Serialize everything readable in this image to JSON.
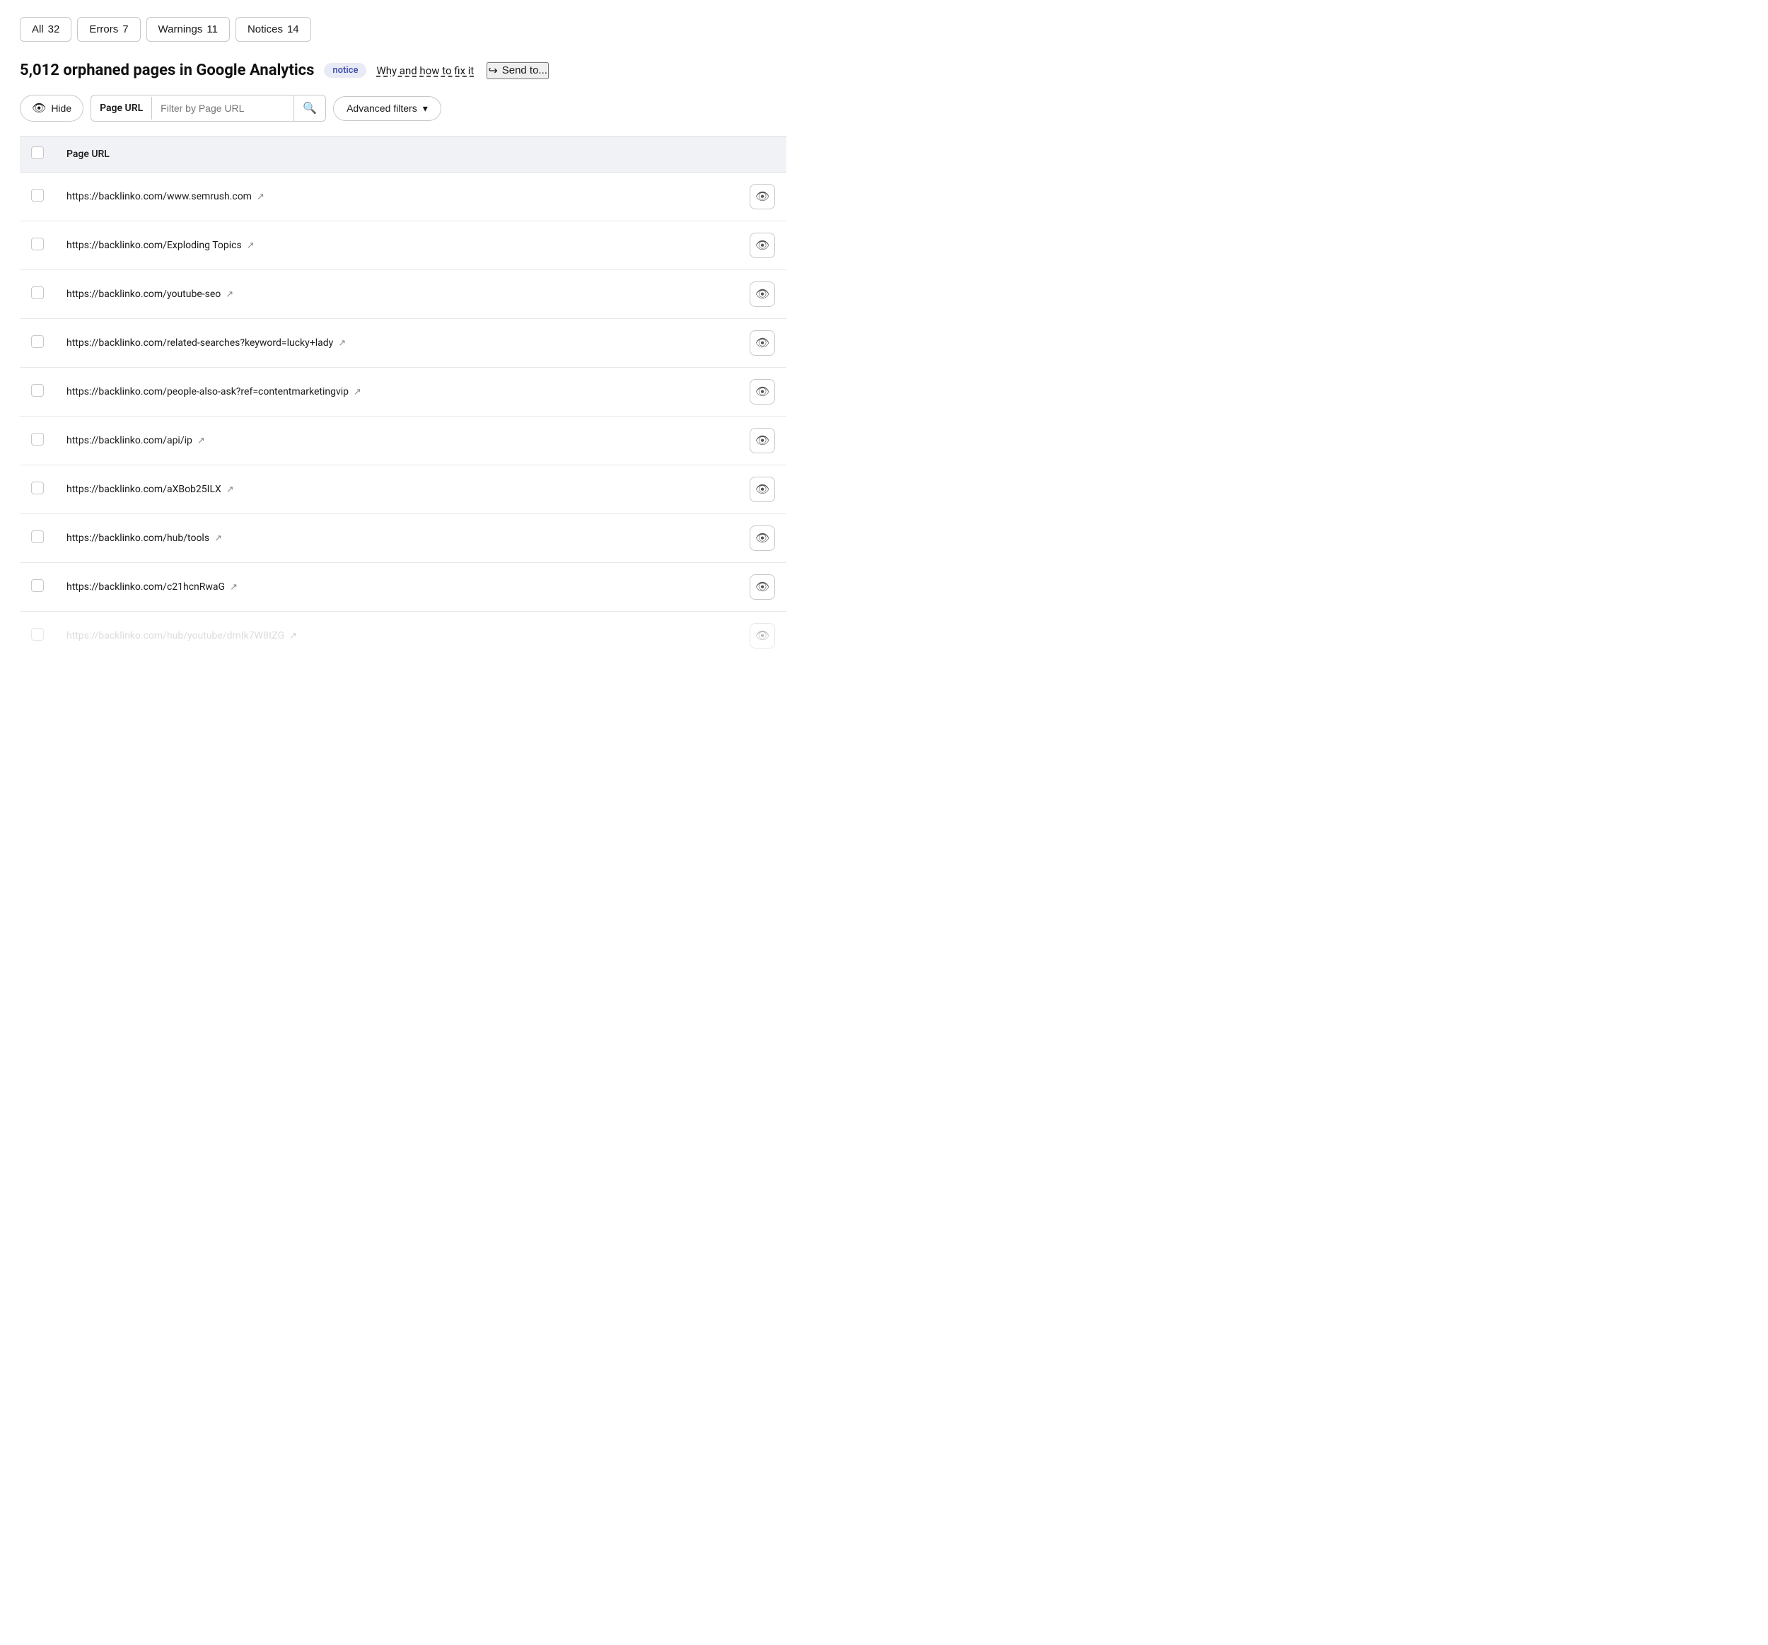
{
  "tabs": [
    {
      "label": "All",
      "count": "32",
      "id": "all"
    },
    {
      "label": "Errors",
      "count": "7",
      "id": "errors"
    },
    {
      "label": "Warnings",
      "count": "11",
      "id": "warnings"
    },
    {
      "label": "Notices",
      "count": "14",
      "id": "notices"
    }
  ],
  "heading": {
    "title": "5,012 orphaned pages in Google Analytics",
    "badge": "notice",
    "fix_link": "Why and how to fix it",
    "send_to": "Send to..."
  },
  "filters": {
    "hide_label": "Hide",
    "url_label": "Page URL",
    "url_placeholder": "Filter by Page URL",
    "advanced_label": "Advanced filters"
  },
  "table": {
    "header": {
      "url_col": "Page URL"
    },
    "rows": [
      {
        "url": "https://backlinko.com/www.semrush.com",
        "muted": false
      },
      {
        "url": "https://backlinko.com/Exploding Topics",
        "muted": false
      },
      {
        "url": "https://backlinko.com/youtube-seo",
        "muted": false
      },
      {
        "url": "https://backlinko.com/related-searches?keyword=lucky+lady",
        "muted": false
      },
      {
        "url": "https://backlinko.com/people-also-ask?ref=contentmarketingvip",
        "muted": false
      },
      {
        "url": "https://backlinko.com/api/ip",
        "muted": false
      },
      {
        "url": "https://backlinko.com/aXBob25ILX",
        "muted": false
      },
      {
        "url": "https://backlinko.com/hub/tools",
        "muted": false
      },
      {
        "url": "https://backlinko.com/c21hcnRwaG",
        "muted": false
      },
      {
        "url": "https://backlinko.com/hub/youtube/dmIk7W8tZG",
        "muted": true
      }
    ]
  },
  "icons": {
    "eye": "👁",
    "search": "🔍",
    "external": "↗",
    "chevron_down": "▾",
    "send_arrow": "↪"
  }
}
